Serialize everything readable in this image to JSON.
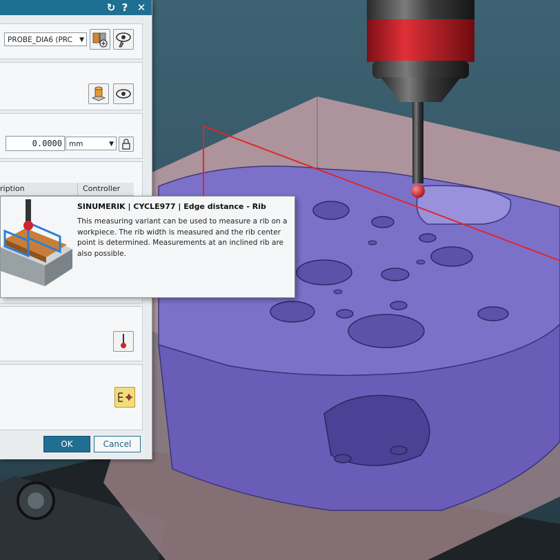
{
  "dialog": {
    "title_buttons": {
      "reset": "↻",
      "help": "?",
      "close": "✕"
    },
    "probe_select": {
      "value": "PROBE_DIA6 (PRC"
    },
    "offset": {
      "value": "0.0000",
      "unit": "mm"
    },
    "table_headers": {
      "description": "ription",
      "controller": "Controller"
    },
    "ok_label": "OK",
    "cancel_label": "Cancel"
  },
  "tooltip": {
    "title": "SINUMERIK | CYCLE977 | Edge distance - Rib",
    "body": "This measuring variant can be used to measure a rib on a workpiece. The rib width is measured and the rib center point is determined. Measurements at an inclined rib are also possible."
  },
  "colors": {
    "titlebar": "#1f6f92",
    "ok_button": "#1f6f92",
    "part": "#7a6fc4",
    "stock": "#b49a9f",
    "probe_ball": "#d3242e",
    "measure_line": "#e0262a"
  },
  "icons": [
    "reset-icon",
    "help-icon",
    "close-icon",
    "tool-library-icon",
    "display-tool-icon",
    "specify-geometry-icon",
    "show-icon",
    "lock-icon",
    "probe-tool-icon",
    "operation-cycle-icon",
    "rib-probing-thumbnail"
  ]
}
